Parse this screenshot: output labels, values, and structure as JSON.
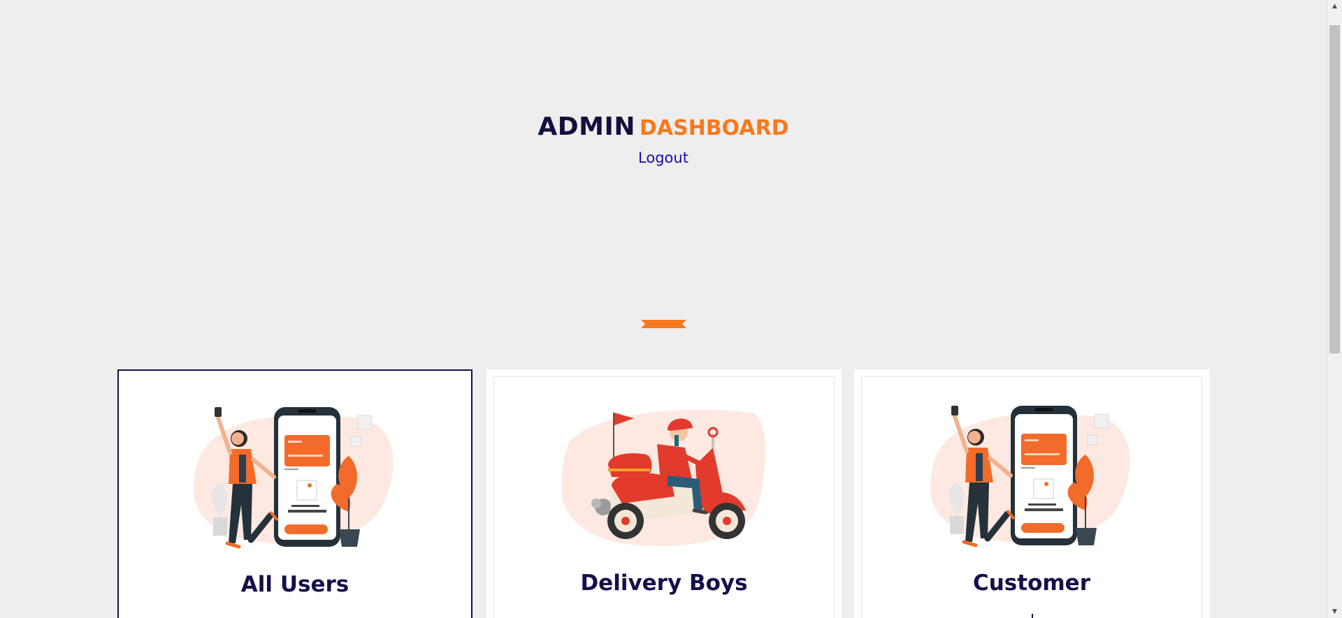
{
  "header": {
    "title_part1": "ADMIN",
    "title_part2": "DASHBOARD",
    "logout_label": "Logout"
  },
  "colors": {
    "navy": "#13103d",
    "accent_orange": "#f7791e",
    "link_blue": "#1a0dab",
    "page_bg": "#eeeeee"
  },
  "cards": [
    {
      "label": "All Users",
      "illustration": "woman-phone-payment-illustration",
      "selected": true
    },
    {
      "label": "Delivery Boys",
      "illustration": "delivery-scooter-illustration",
      "selected": false
    },
    {
      "label": "Customer",
      "illustration": "woman-phone-payment-illustration",
      "selected": false
    }
  ],
  "icons": {
    "scroll_up": "triangle-up-icon",
    "scroll_down": "triangle-down-icon",
    "divider": "ribbon-divider-icon"
  }
}
